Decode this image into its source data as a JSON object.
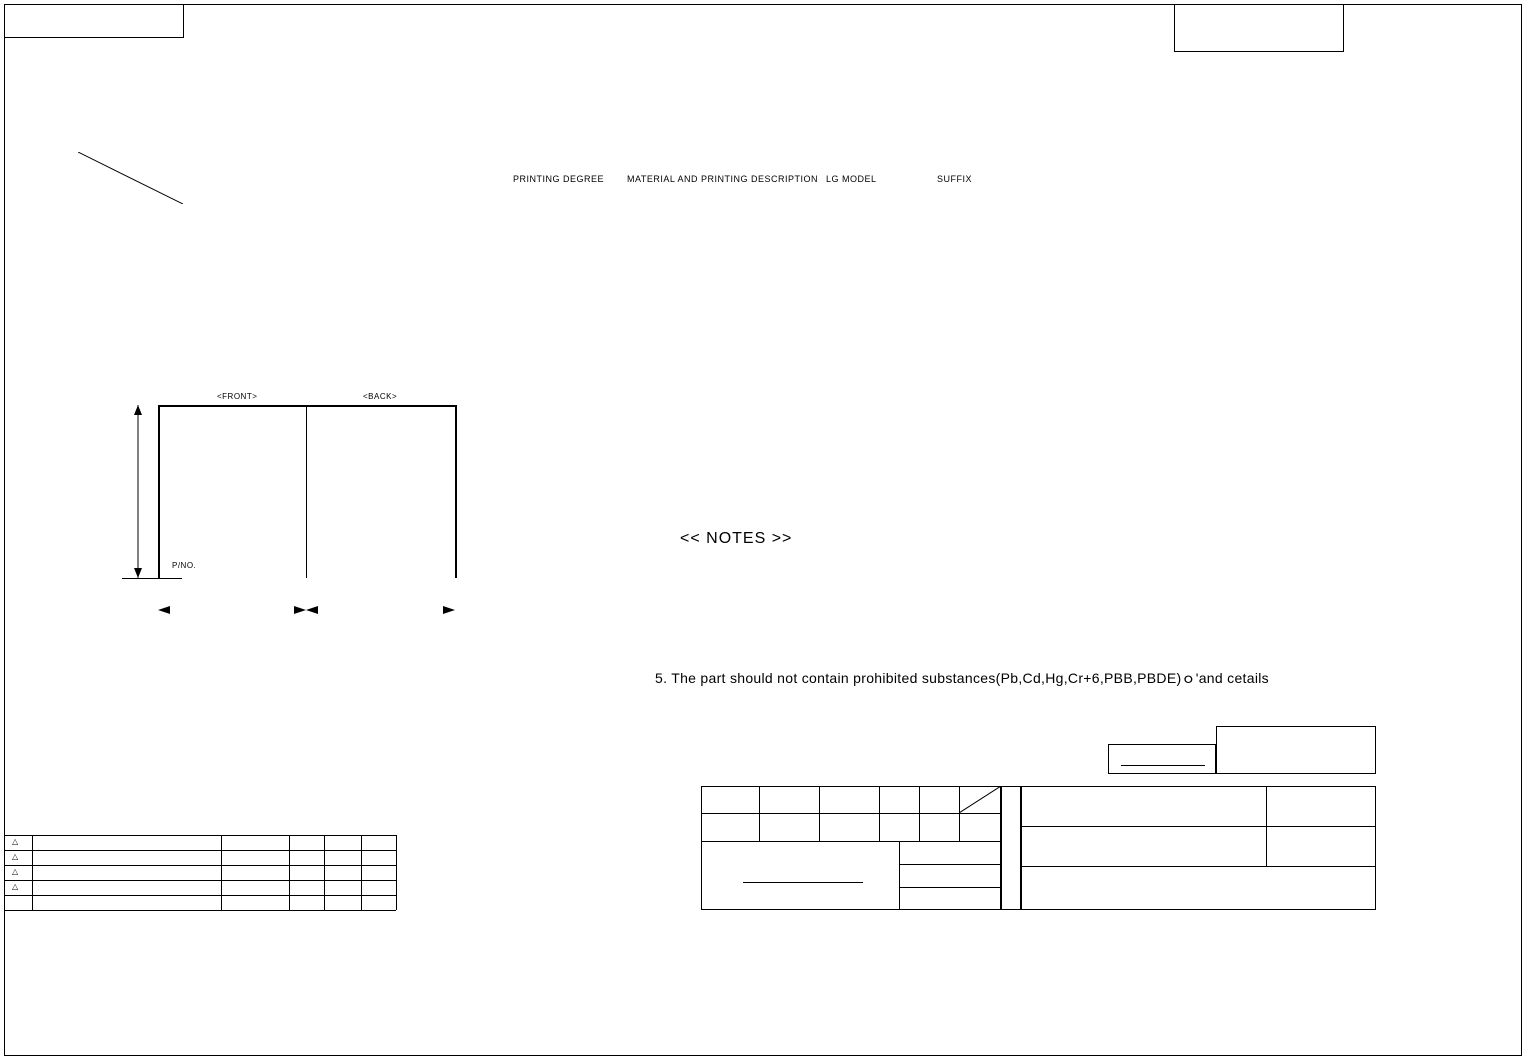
{
  "header_cols": {
    "printing_degree": "PRINTING DEGREE",
    "material_desc": "MATERIAL AND PRINTING DESCRIPTION",
    "lg_model": "LG MODEL",
    "suffix": "SUFFIX"
  },
  "front_label": "<FRONT>",
  "back_label": "<BACK>",
  "pno_label": "P/NO.",
  "notes_heading": "<< NOTES >>",
  "note_5": "5. The part should not contain prohibited substances(Pb,Cd,Hg,Cr+6,PBB,PBDE)ｏ'and cetails",
  "rev_symbol": "△"
}
